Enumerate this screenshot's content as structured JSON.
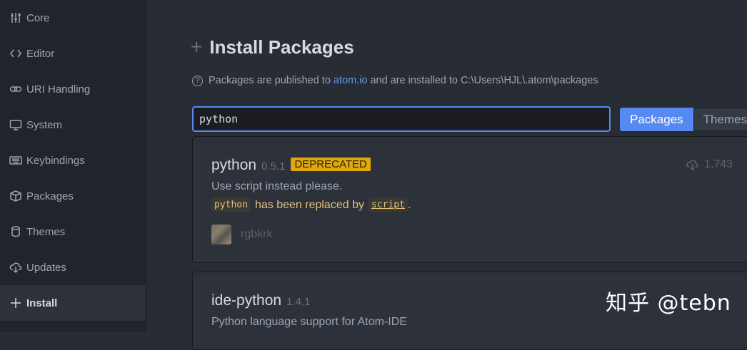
{
  "sidebar": {
    "items": [
      {
        "label": "Core",
        "icon": "sliders-icon"
      },
      {
        "label": "Editor",
        "icon": "code-icon"
      },
      {
        "label": "URI Handling",
        "icon": "link-icon"
      },
      {
        "label": "System",
        "icon": "monitor-icon"
      },
      {
        "label": "Keybindings",
        "icon": "keyboard-icon"
      },
      {
        "label": "Packages",
        "icon": "package-icon"
      },
      {
        "label": "Themes",
        "icon": "paintcan-icon"
      },
      {
        "label": "Updates",
        "icon": "cloud-download-icon"
      },
      {
        "label": "Install",
        "icon": "plus-icon",
        "active": true
      }
    ]
  },
  "install": {
    "plus": "+",
    "title": "Install Packages",
    "info_icon": "?",
    "info_prefix": "Packages are published to",
    "info_link": "atom.io",
    "info_suffix": "and are installed to C:\\Users\\HJL\\.atom\\packages",
    "search_value": "python",
    "tab_packages": "Packages",
    "tab_themes": "Themes"
  },
  "packages": [
    {
      "name": "python",
      "version": "0.5.1",
      "badge": "DEPRECATED",
      "description": "Use script instead please.",
      "replaced_old": "python",
      "replaced_text": "has been replaced by",
      "replaced_new": "script",
      "replaced_end": ".",
      "author": "rgbkrk",
      "downloads": "1,743"
    },
    {
      "name": "ide-python",
      "version": "1.4.1",
      "description": "Python language support for Atom-IDE"
    }
  ],
  "watermark": "知乎 @tebn",
  "colors": {
    "accent": "#568af2",
    "badge": "#e0a80e",
    "link": "#6494ed"
  }
}
